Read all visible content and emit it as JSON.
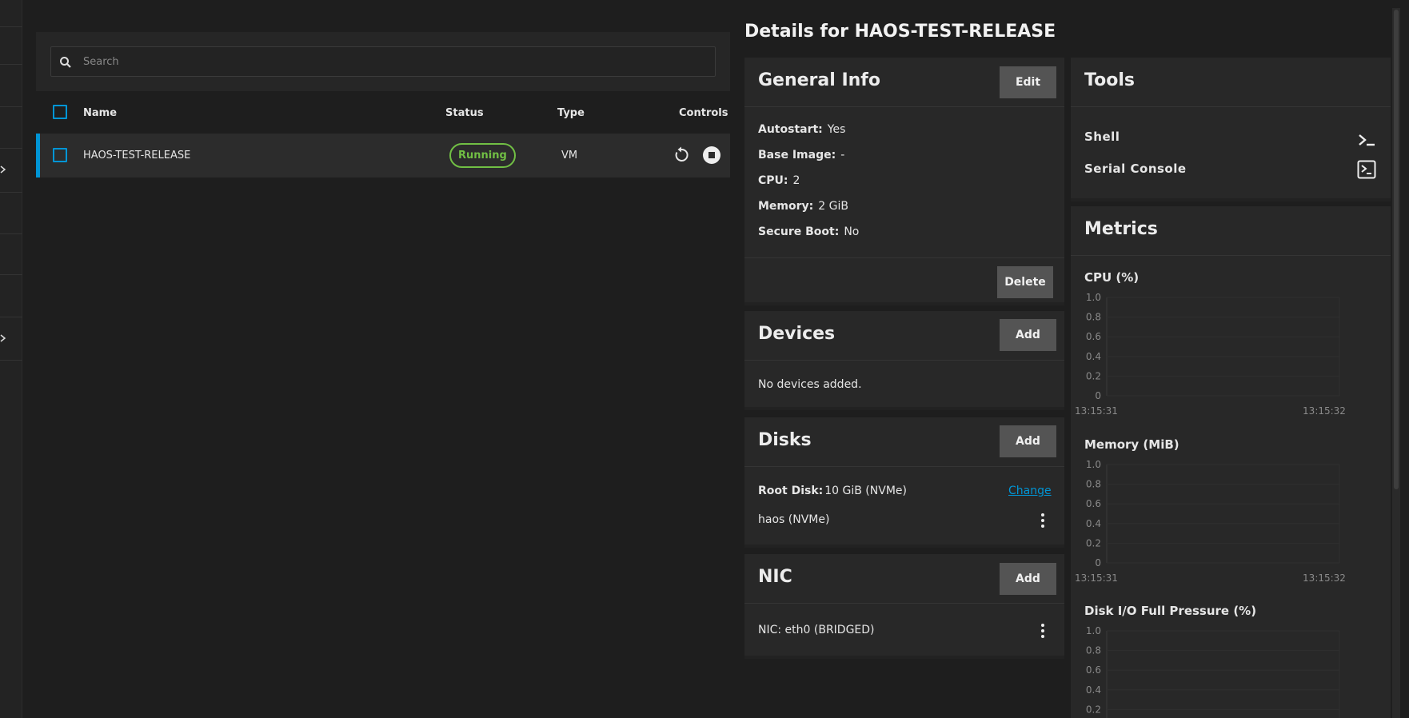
{
  "search": {
    "placeholder": "Search"
  },
  "table": {
    "headers": {
      "name": "Name",
      "status": "Status",
      "type": "Type",
      "controls": "Controls"
    },
    "rows": [
      {
        "name": "HAOS-TEST-RELEASE",
        "status": "Running",
        "type": "VM"
      }
    ]
  },
  "details": {
    "title": "Details for HAOS-TEST-RELEASE",
    "general": {
      "title": "General Info",
      "edit_label": "Edit",
      "delete_label": "Delete",
      "fields": [
        {
          "key": "Autostart:",
          "value": "Yes"
        },
        {
          "key": "Base Image:",
          "value": "-"
        },
        {
          "key": "CPU:",
          "value": "2"
        },
        {
          "key": "Memory:",
          "value": "2 GiB"
        },
        {
          "key": "Secure Boot:",
          "value": "No"
        }
      ]
    },
    "devices": {
      "title": "Devices",
      "add_label": "Add",
      "empty_text": "No devices added."
    },
    "disks": {
      "title": "Disks",
      "add_label": "Add",
      "root_key": "Root Disk:",
      "root_value": "10 GiB (NVMe)",
      "change_label": "Change",
      "disk_item": "haos (NVMe)"
    },
    "nic": {
      "title": "NIC",
      "add_label": "Add",
      "item": "NIC: eth0 (BRIDGED)"
    },
    "tools": {
      "title": "Tools",
      "items": [
        {
          "label": "Shell",
          "icon": "terminal-icon"
        },
        {
          "label": "Serial Console",
          "icon": "console-box-icon"
        }
      ]
    },
    "metrics": {
      "title": "Metrics"
    }
  },
  "chart_data": [
    {
      "type": "line",
      "title": "CPU (%)",
      "y_ticks": [
        "1.0",
        "0.8",
        "0.6",
        "0.4",
        "0.2",
        "0"
      ],
      "x_ticks": [
        "13:15:31",
        "13:15:32"
      ],
      "ylim": [
        0,
        1
      ],
      "series": []
    },
    {
      "type": "line",
      "title": "Memory (MiB)",
      "y_ticks": [
        "1.0",
        "0.8",
        "0.6",
        "0.4",
        "0.2",
        "0"
      ],
      "x_ticks": [
        "13:15:31",
        "13:15:32"
      ],
      "ylim": [
        0,
        1
      ],
      "series": []
    },
    {
      "type": "line",
      "title": "Disk I/O Full Pressure (%)",
      "y_ticks": [
        "1.0",
        "0.8",
        "0.6",
        "0.4",
        "0.2"
      ],
      "x_ticks": [],
      "ylim": [
        0,
        1
      ],
      "series": []
    }
  ]
}
